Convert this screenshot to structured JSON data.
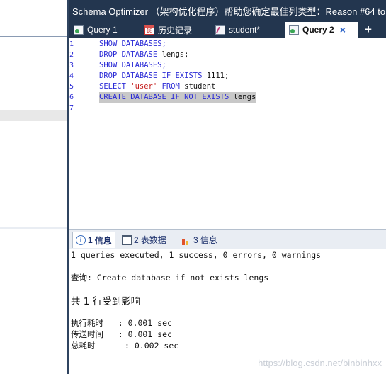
{
  "window": {
    "title": "Schema Optimizer （架构优化程序）帮助您确定最佳列类型：Reason #64 to"
  },
  "tabs": [
    {
      "label": "Query 1",
      "icon": "query-icon",
      "active": false
    },
    {
      "label": "历史记录",
      "icon": "calendar-icon",
      "icon_text": "18",
      "active": false
    },
    {
      "label": "student*",
      "icon": "table-icon",
      "active": false
    },
    {
      "label": "Query 2",
      "icon": "query-icon",
      "active": true,
      "close": "×"
    }
  ],
  "add_tab_label": "+",
  "editor": {
    "lines": [
      {
        "num": "1",
        "segments": [
          {
            "t": "SHOW DATABASES;",
            "c": "kw"
          }
        ]
      },
      {
        "num": "2",
        "segments": [
          {
            "t": "DROP DATABASE ",
            "c": "kw"
          },
          {
            "t": "lengs;",
            "c": "plain"
          }
        ]
      },
      {
        "num": "3",
        "segments": [
          {
            "t": "SHOW DATABASES;",
            "c": "kw"
          }
        ]
      },
      {
        "num": "4",
        "segments": [
          {
            "t": "DROP DATABASE IF EXISTS ",
            "c": "kw"
          },
          {
            "t": "1111;",
            "c": "plain"
          }
        ]
      },
      {
        "num": "5",
        "segments": [
          {
            "t": "SELECT ",
            "c": "kw"
          },
          {
            "t": "'user'",
            "c": "str"
          },
          {
            "t": " FROM ",
            "c": "kw"
          },
          {
            "t": "student",
            "c": "plain"
          }
        ]
      },
      {
        "num": "6",
        "selected": true,
        "segments": [
          {
            "t": "CREATE DATABASE IF NOT EXISTS ",
            "c": "kw"
          },
          {
            "t": "lengs",
            "c": "plain"
          }
        ]
      },
      {
        "num": "7",
        "segments": []
      }
    ]
  },
  "result_tabs": [
    {
      "num": "1",
      "label": "信息",
      "icon": "info-icon",
      "icon_text": "i",
      "active": true
    },
    {
      "num": "2",
      "label": "表数据",
      "icon": "grid-icon",
      "active": false
    },
    {
      "num": "3",
      "label": "信息",
      "icon": "chart-icon",
      "active": false
    }
  ],
  "results": {
    "summary": "1 queries executed, 1 success, 0 errors, 0 warnings",
    "query": "查询: Create database if not exists lengs",
    "affected": "共 1 行受到影响",
    "exec_time": "执行耗时   : 0.001 sec",
    "transfer_time": "传送时间   : 0.001 sec",
    "total_time": "总耗时      : 0.002 sec"
  },
  "watermark": "https://blog.csdn.net/binbinhxx",
  "colors": {
    "title_bar": "#23364f",
    "keyword": "#2b2bd6",
    "string": "#c41a1a",
    "selection": "#c8c8c8"
  }
}
